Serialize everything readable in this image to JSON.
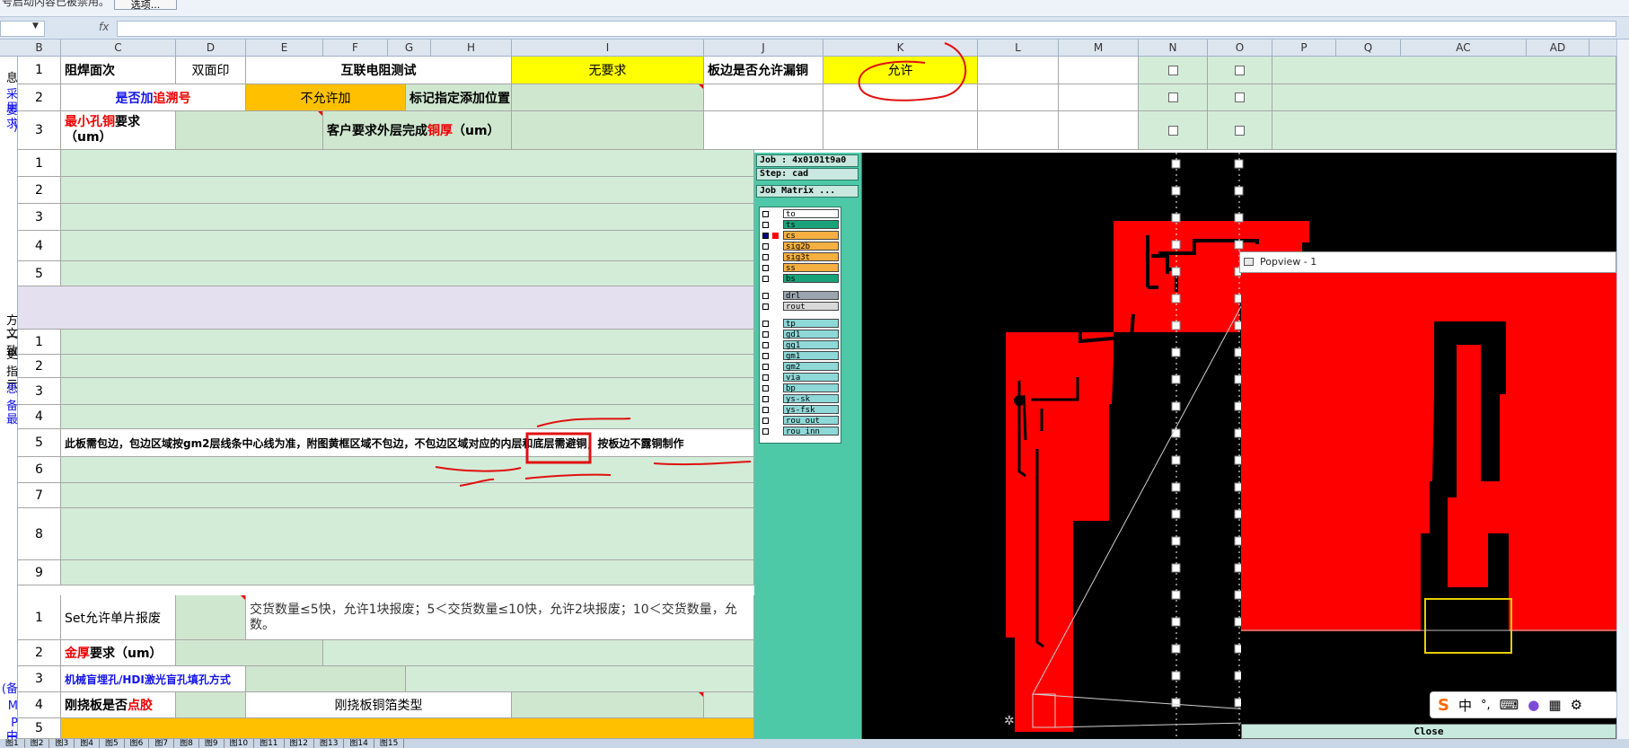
{
  "notification": {
    "text": "号启动内容已被禁用。",
    "options_button": "选项..."
  },
  "formula_bar": {
    "fx_label": "fx",
    "namebox_value": "",
    "formula_value": ""
  },
  "columns": [
    "B",
    "C",
    "D",
    "E",
    "F",
    "G",
    "H",
    "I",
    "J",
    "K",
    "L",
    "M",
    "N",
    "O",
    "P",
    "Q",
    "AC",
    "AD"
  ],
  "left_labels": [
    {
      "text": "息",
      "color": "#000"
    },
    {
      "text": "采用",
      "color": "#1414e6"
    },
    {
      "text": "要求",
      "color": "#1414e6"
    },
    {
      "text": ")",
      "color": "#1414e6"
    },
    {
      "text": "方文",
      "color": "#000"
    },
    {
      "text": "一致",
      "color": "#000"
    },
    {
      "text": "更",
      "color": "#000"
    },
    {
      "text": "指示",
      "color": "#000"
    },
    {
      "text": "息",
      "color": "#1414e6"
    },
    {
      "text": "备最",
      "color": "#1414e6"
    },
    {
      "text": "(备",
      "color": "#1414e6"
    },
    {
      "text": "M",
      "color": "#1414e6"
    },
    {
      "text": "P中",
      "color": "#1414e6"
    },
    {
      "text": "中",
      "color": "#1414e6"
    }
  ],
  "top_block": {
    "row1": {
      "c": "阻焊面次",
      "d": "双面印",
      "ef": "互联电阻测试",
      "i": "无要求",
      "j": "板边是否允许漏铜",
      "k": "允许"
    },
    "row2": {
      "c1": "是否加",
      "c2": "追溯号",
      "e": "不允许加",
      "gh": "标记指定添加位置"
    },
    "row3": {
      "c_red": "最小孔铜",
      "c_rest": "要求",
      "c_line2": "（um）",
      "fgh1": "客户要求外层完成",
      "fgh_red": "铜厚",
      "fgh2": "（um）"
    }
  },
  "row_numbers_top": [
    "1",
    "2",
    "3"
  ],
  "row_numbers_mid1": [
    "1",
    "2",
    "3",
    "4",
    "5"
  ],
  "row_numbers_mid2": [
    "1",
    "2",
    "3",
    "4",
    "5",
    "6",
    "7",
    "8",
    "9"
  ],
  "row_numbers_bot": [
    "1",
    "2",
    "3",
    "4",
    "5"
  ],
  "note_row5": "此板需包边，包边区域按gm2层线条中心线为准，附图黄框区域不包边，不包边区域对应的内层和底层需避铜，按板边不露铜制作",
  "bottom_block": {
    "r1_c": "Set允许单片报废",
    "r1_text1": "交货数量≤5快，允许1块报废；5＜交货数量≤10快，允许2块报废；10＜交货数量，允",
    "r1_text2": "数。",
    "r2_red": "金厚",
    "r2_rest": "要求（um）",
    "r3": "机械盲埋孔/HDI激光盲孔填孔方式",
    "r4_a": "刚挠板是否",
    "r4_red": "点胶",
    "r4_e": "刚挠板铜箔类型"
  },
  "cam": {
    "job": "Job : 4x0101t9a0",
    "step": "Step: cad",
    "matrix_button": "Job Matrix ...",
    "layers": [
      {
        "name": "to",
        "color": "#ffffff"
      },
      {
        "name": "ts",
        "color": "#1aa37a"
      },
      {
        "name": "cs",
        "color": "#f5b041"
      },
      {
        "name": "sig2b",
        "color": "#f5b041"
      },
      {
        "name": "sig3t",
        "color": "#f5b041"
      },
      {
        "name": "ss",
        "color": "#f5b041"
      },
      {
        "name": "bs",
        "color": "#1aa37a"
      },
      {
        "name": "drl",
        "color": "#9aa5b0"
      },
      {
        "name": "rout",
        "color": "#d9d9d9"
      },
      {
        "name": "tp",
        "color": "#8fd8d8"
      },
      {
        "name": "gd1",
        "color": "#8fd8d8"
      },
      {
        "name": "gg1",
        "color": "#8fd8d8"
      },
      {
        "name": "gm1",
        "color": "#8fd8d8"
      },
      {
        "name": "gm2",
        "color": "#8fd8d8"
      },
      {
        "name": "via",
        "color": "#8fd8d8"
      },
      {
        "name": "bp",
        "color": "#8fd8d8"
      },
      {
        "name": "ys-sk",
        "color": "#8fd8d8"
      },
      {
        "name": "ys-fsk",
        "color": "#8fd8d8"
      },
      {
        "name": "rou_out",
        "color": "#8fd8d8"
      },
      {
        "name": "rou_inn",
        "color": "#8fd8d8"
      }
    ],
    "popview_title": "Popview - 1",
    "close_label": "Close",
    "accent_red": "#ff0000"
  },
  "ime": {
    "lang": "中",
    "punct": "°,"
  },
  "sheet_tabs": [
    "图1",
    "图2",
    "图3",
    "图4",
    "图5",
    "图6",
    "图7",
    "图8",
    "图9",
    "图10",
    "图11",
    "图12",
    "图13",
    "图14",
    "图15"
  ]
}
